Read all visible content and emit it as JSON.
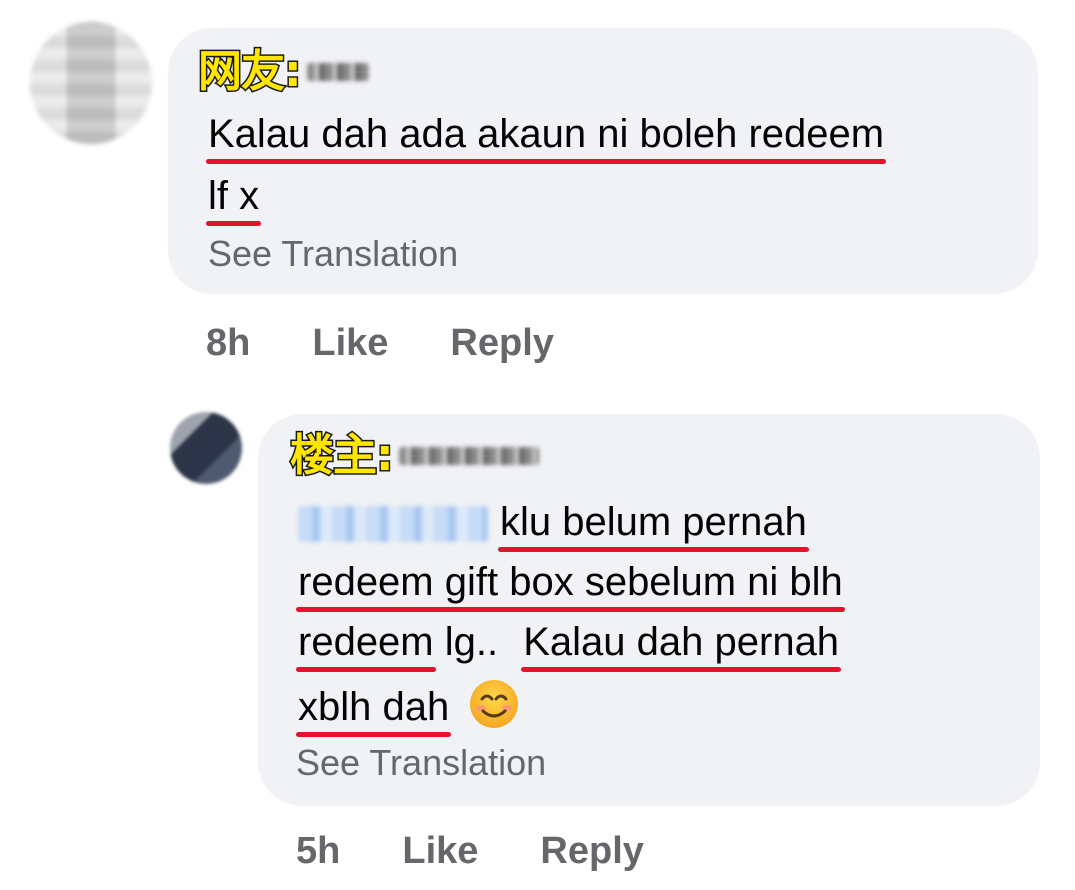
{
  "comments": [
    {
      "tag": "网友:",
      "lines": [
        "Kalau dah ada akaun ni boleh redeem",
        "lf x"
      ],
      "see_translation": "See Translation",
      "time": "8h",
      "like": "Like",
      "reply": "Reply"
    },
    {
      "tag": "楼主:",
      "lines": [
        "klu belum pernah",
        "redeem gift box sebelum ni blh",
        "redeem",
        "lg..",
        "Kalau dah pernah",
        "xblh dah"
      ],
      "emoji": "smiling-face-icon",
      "see_translation": "See Translation",
      "time": "5h",
      "like": "Like",
      "reply": "Reply"
    }
  ],
  "colors": {
    "bubble": "#f0f2f5",
    "underline": "#e8112d",
    "tag_fill": "#ffe600",
    "meta_text": "#65676b"
  }
}
